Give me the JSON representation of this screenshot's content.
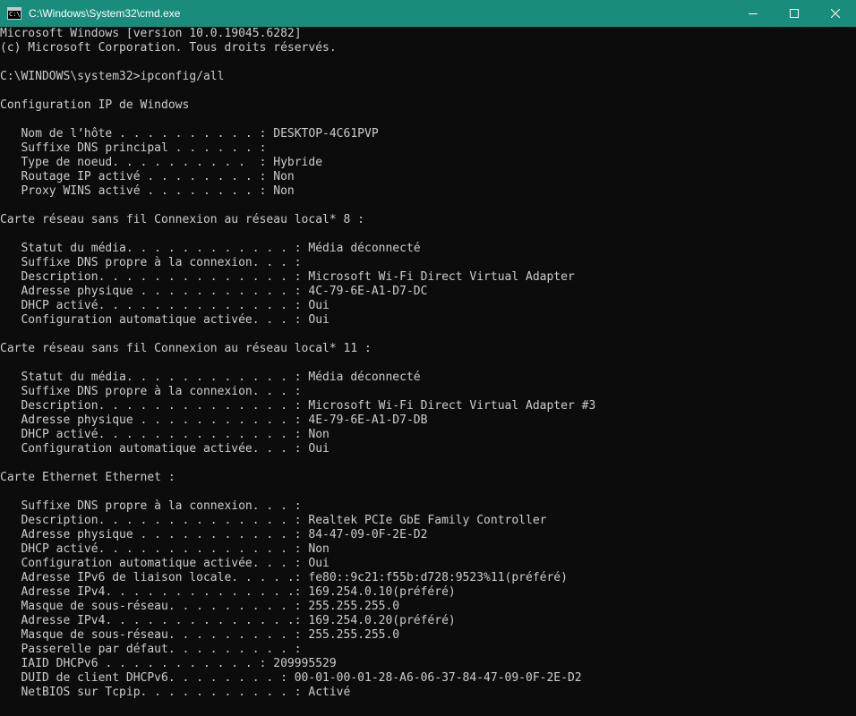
{
  "window": {
    "title": "C:\\Windows\\System32\\cmd.exe",
    "icon": "cmd-icon",
    "icon_text": "C:\\",
    "controls": [
      "minimize-icon",
      "maximize-icon",
      "close-icon"
    ],
    "titlebar_color": "#1a8c7c"
  },
  "console": {
    "text_color": "#cccccc",
    "background": "#0c0c0c",
    "lines": [
      "Microsoft Windows [version 10.0.19045.6282]",
      "(c) Microsoft Corporation. Tous droits réservés.",
      "",
      "C:\\WINDOWS\\system32>ipconfig/all",
      "",
      "Configuration IP de Windows",
      "",
      "   Nom de l’hôte . . . . . . . . . . : DESKTOP-4C61PVP",
      "   Suffixe DNS principal . . . . . . :",
      "   Type de noeud. . . . . . . . . .  : Hybride",
      "   Routage IP activé . . . . . . . . : Non",
      "   Proxy WINS activé . . . . . . . . : Non",
      "",
      "Carte réseau sans fil Connexion au réseau local* 8 :",
      "",
      "   Statut du média. . . . . . . . . . . . : Média déconnecté",
      "   Suffixe DNS propre à la connexion. . . :",
      "   Description. . . . . . . . . . . . . . : Microsoft Wi-Fi Direct Virtual Adapter",
      "   Adresse physique . . . . . . . . . . . : 4C-79-6E-A1-D7-DC",
      "   DHCP activé. . . . . . . . . . . . . . : Oui",
      "   Configuration automatique activée. . . : Oui",
      "",
      "Carte réseau sans fil Connexion au réseau local* 11 :",
      "",
      "   Statut du média. . . . . . . . . . . . : Média déconnecté",
      "   Suffixe DNS propre à la connexion. . . :",
      "   Description. . . . . . . . . . . . . . : Microsoft Wi-Fi Direct Virtual Adapter #3",
      "   Adresse physique . . . . . . . . . . . : 4E-79-6E-A1-D7-DB",
      "   DHCP activé. . . . . . . . . . . . . . : Non",
      "   Configuration automatique activée. . . : Oui",
      "",
      "Carte Ethernet Ethernet :",
      "",
      "   Suffixe DNS propre à la connexion. . . :",
      "   Description. . . . . . . . . . . . . . : Realtek PCIe GbE Family Controller",
      "   Adresse physique . . . . . . . . . . . : 84-47-09-0F-2E-D2",
      "   DHCP activé. . . . . . . . . . . . . . : Non",
      "   Configuration automatique activée. . . : Oui",
      "   Adresse IPv6 de liaison locale. . . . .: fe80::9c21:f55b:d728:9523%11(préféré)",
      "   Adresse IPv4. . . . . . . . . . . . . .: 169.254.0.10(préféré)",
      "   Masque de sous-réseau. . . . . . . . . : 255.255.255.0",
      "   Adresse IPv4. . . . . . . . . . . . . .: 169.254.0.20(préféré)",
      "   Masque de sous-réseau. . . . . . . . . : 255.255.255.0",
      "   Passerelle par défaut. . . . . . . . . :",
      "   IAID DHCPv6 . . . . . . . . . . . : 209995529",
      "   DUID de client DHCPv6. . . . . . . . : 00-01-00-01-28-A6-06-37-84-47-09-0F-2E-D2",
      "   NetBIOS sur Tcpip. . . . . . . . . . . : Activé"
    ]
  }
}
